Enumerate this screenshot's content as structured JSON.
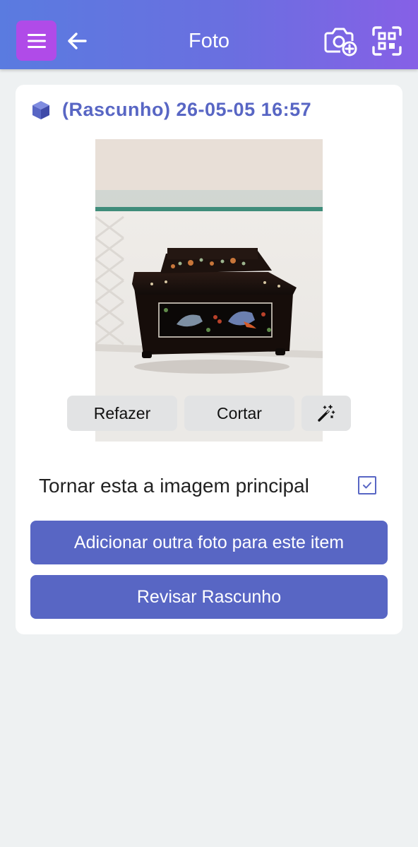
{
  "appbar": {
    "title": "Foto",
    "menu_icon": "menu-icon",
    "back_icon": "arrow-left-icon",
    "camera_add_icon": "camera-add-icon",
    "scan_icon": "qr-scan-icon",
    "colors": {
      "gradient_start": "#5a7be0",
      "gradient_end": "#8660e6",
      "menu_bg": "#b04be8"
    }
  },
  "card": {
    "header_icon": "cube-icon",
    "title": "(Rascunho) 26-05-05 16:57",
    "photo_alt": "photo",
    "photo_buttons": {
      "redo_label": "Refazer",
      "crop_label": "Cortar",
      "magic_icon": "magic-wand-icon"
    },
    "main_image": {
      "label": "Tornar esta a imagem principal",
      "checked": true
    },
    "actions": {
      "add_photo_label": "Adicionar outra foto para este item",
      "review_label": "Revisar Rascunho"
    },
    "colors": {
      "accent": "#5866c4",
      "background": "#eef1f2"
    }
  }
}
